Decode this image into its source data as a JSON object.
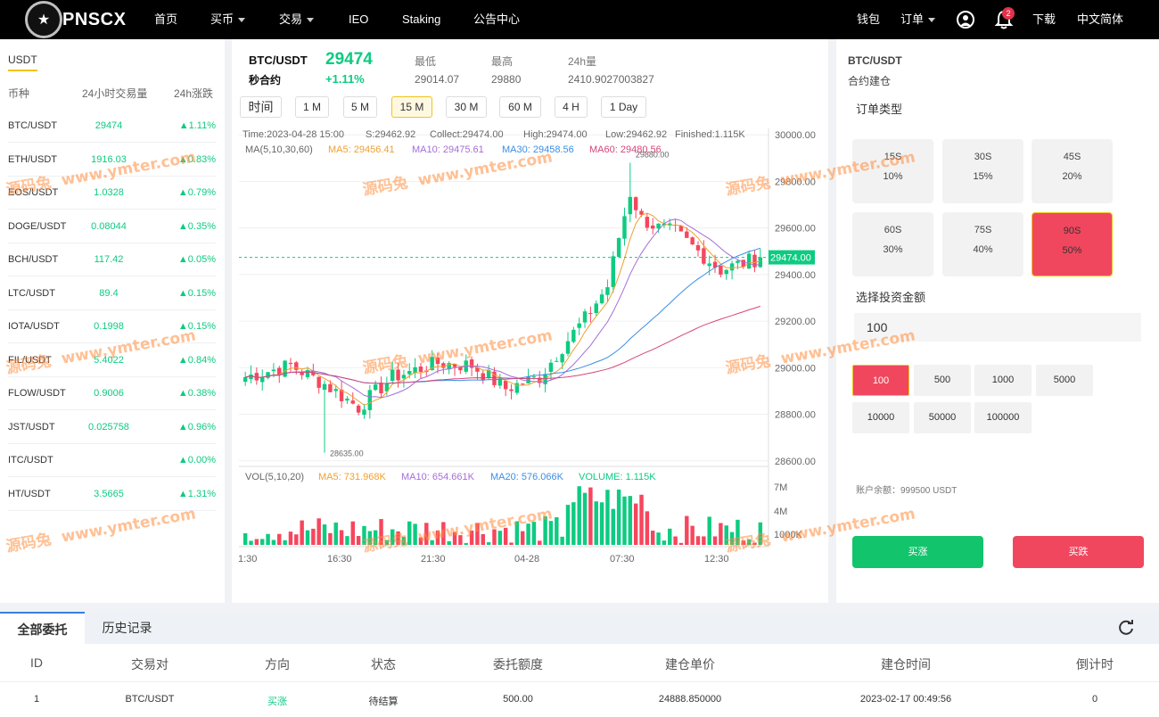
{
  "nav": {
    "logo_text": "PNSCX",
    "items": [
      {
        "label": "首页",
        "dropdown": false
      },
      {
        "label": "买币",
        "dropdown": true
      },
      {
        "label": "交易",
        "dropdown": true
      },
      {
        "label": "IEO",
        "dropdown": false
      },
      {
        "label": "Staking",
        "dropdown": false
      },
      {
        "label": "公告中心",
        "dropdown": false
      }
    ],
    "wallet": "钱包",
    "orders": "订单",
    "notification_count": "2",
    "download": "下载",
    "language": "中文简体"
  },
  "market": {
    "tab": "USDT",
    "headers": [
      "币种",
      "24小时交易量",
      "24h涨跌"
    ],
    "rows": [
      {
        "pair": "BTC/USDT",
        "volume": "29474",
        "change": "1.11%"
      },
      {
        "pair": "ETH/USDT",
        "volume": "1916.03",
        "change": "0.83%"
      },
      {
        "pair": "EOS/USDT",
        "volume": "1.0328",
        "change": "0.79%"
      },
      {
        "pair": "DOGE/USDT",
        "volume": "0.08044",
        "change": "0.35%"
      },
      {
        "pair": "BCH/USDT",
        "volume": "117.42",
        "change": "0.05%"
      },
      {
        "pair": "LTC/USDT",
        "volume": "89.4",
        "change": "0.15%"
      },
      {
        "pair": "IOTA/USDT",
        "volume": "0.1998",
        "change": "0.15%"
      },
      {
        "pair": "FIL/USDT",
        "volume": "5.4022",
        "change": "0.84%"
      },
      {
        "pair": "FLOW/USDT",
        "volume": "0.9006",
        "change": "0.38%"
      },
      {
        "pair": "JST/USDT",
        "volume": "0.025758",
        "change": "0.96%"
      },
      {
        "pair": "ITC/USDT",
        "volume": "",
        "change": "0.00%"
      },
      {
        "pair": "HT/USDT",
        "volume": "3.5665",
        "change": "1.31%"
      }
    ]
  },
  "ticker": {
    "pair": "BTC/USDT",
    "subtitle": "秒合约",
    "price": "29474",
    "change": "+1.11%",
    "low_label": "最低",
    "low": "29014.07",
    "high_label": "最高",
    "high": "29880",
    "vol_label": "24h量",
    "vol": "2410.9027003827"
  },
  "timeframes": [
    "时间",
    "1 M",
    "5 M",
    "15 M",
    "30 M",
    "60 M",
    "4 H",
    "1 Day"
  ],
  "active_timeframe": "15 M",
  "chart_info": {
    "time": "Time:2023-04-28 15:00",
    "s": "S:29462.92",
    "collect": "Collect:29474.00",
    "high": "High:29474.00",
    "low": "Low:29462.92",
    "finished": "Finished:1.115K",
    "ma_label": "MA(5,10,30,60)",
    "ma5": "MA5: 29456.41",
    "ma10": "MA10: 29475.61",
    "ma30": "MA30: 29458.56",
    "ma60": "MA60: 29480.56",
    "vol_label": "VOL(5,10,20)",
    "vma5": "MA5: 731.968K",
    "vma10": "MA10: 654.661K",
    "vma20": "MA20: 576.066K",
    "volume": "VOLUME: 1.115K",
    "max_label": "29880.00",
    "min_label": "28635.00",
    "last_label": "29474.00"
  },
  "chart_data": {
    "type": "candlestick",
    "y_ticks": [
      "30000.00",
      "29800.00",
      "29600.00",
      "29400.00",
      "29200.00",
      "29000.00",
      "28800.00",
      "28600.00"
    ],
    "ylim": [
      28580,
      30020
    ],
    "vol_ticks": [
      "7M",
      "4M",
      "1000K"
    ],
    "x_ticks": [
      "1:30",
      "16:30",
      "21:30",
      "04-28",
      "07:30",
      "12:30"
    ],
    "colors": {
      "up": "#0ecb81",
      "down": "#f6465d",
      "ma5": "#f0a030",
      "ma10": "#a56ed8",
      "ma30": "#3a8ee6",
      "ma60": "#d6457a"
    }
  },
  "trade": {
    "title": "BTC/USDT",
    "subtitle": "合约建仓",
    "order_type_label": "订单类型",
    "options": [
      {
        "time": "15S",
        "rate": "10%"
      },
      {
        "time": "30S",
        "rate": "15%"
      },
      {
        "time": "45S",
        "rate": "20%"
      },
      {
        "time": "60S",
        "rate": "30%"
      },
      {
        "time": "75S",
        "rate": "40%"
      },
      {
        "time": "90S",
        "rate": "50%"
      }
    ],
    "selected_option": 5,
    "amount_label": "选择投资金额",
    "amount_value": "100",
    "amounts": [
      "100",
      "500",
      "1000",
      "5000",
      "10000",
      "50000",
      "100000"
    ],
    "selected_amount": 0,
    "balance": "账户余额：999500 USDT",
    "buy_up": "买涨",
    "buy_down": "买跌"
  },
  "orders": {
    "tabs": [
      "全部委托",
      "历史记录"
    ],
    "headers": [
      "ID",
      "交易对",
      "方向",
      "状态",
      "委托额度",
      "建仓单价",
      "建仓时间",
      "倒计时"
    ],
    "rows": [
      [
        "1",
        "BTC/USDT",
        "买涨",
        "待结算",
        "500.00",
        "24888.850000",
        "2023-02-17 00:49:56",
        "0"
      ]
    ]
  },
  "watermark": {
    "site": "源码兔",
    "url": "www.ymter.com"
  }
}
